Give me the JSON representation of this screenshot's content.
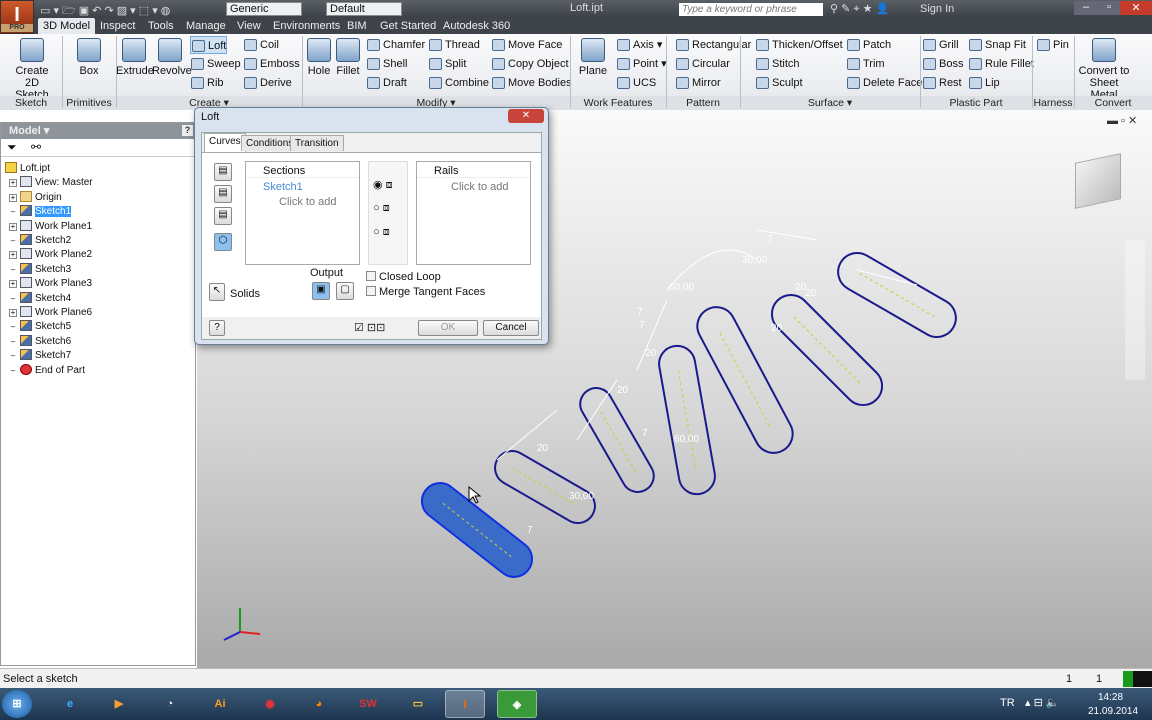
{
  "app": {
    "title": "Loft.ipt",
    "logo": "I",
    "edition": "PRO"
  },
  "quick_access": {
    "material": "Generic",
    "appearance": "Default"
  },
  "help": {
    "search_placeholder": "Type a keyword or phrase",
    "sign_in": "Sign In"
  },
  "tabs": [
    "3D Model",
    "Inspect",
    "Tools",
    "Manage",
    "View",
    "Environments",
    "BIM",
    "Get Started",
    "Autodesk 360"
  ],
  "ribbon": {
    "large": [
      "Create\n2D Sketch",
      "Box",
      "Extrude",
      "Revolve",
      "Hole",
      "Fillet",
      "Plane",
      "Convert to\nSheet Metal"
    ],
    "columns": [
      [
        "Loft",
        "Sweep",
        "Rib"
      ],
      [
        "Coil",
        "Emboss",
        "Derive"
      ],
      [
        "Chamfer",
        "Shell",
        "Draft"
      ],
      [
        "Thread",
        "Split",
        "Combine"
      ],
      [
        "Move Face",
        "Copy Object",
        "Move Bodies"
      ],
      [
        "Axis ▾",
        "Point ▾",
        "UCS"
      ],
      [
        "Rectangular",
        "Circular",
        "Mirror"
      ],
      [
        "Thicken/Offset",
        "Stitch",
        "Sculpt"
      ],
      [
        "Patch",
        "Trim",
        "Delete Face"
      ],
      [
        "Grill",
        "Boss",
        "Rest"
      ],
      [
        "Snap Fit",
        "Rule Fillet",
        "Lip"
      ],
      [
        "Pin",
        "",
        ""
      ]
    ],
    "selected": "Loft",
    "panels": [
      "Sketch",
      "Primitives",
      "Create ▾",
      "Modify ▾",
      "Work Features",
      "Pattern",
      "Surface ▾",
      "Plastic Part",
      "Harness",
      "Convert"
    ]
  },
  "browser": {
    "title": "Model ▾",
    "tree": [
      {
        "label": "Loft.ipt",
        "icon": "part",
        "level": 0
      },
      {
        "label": "View: Master",
        "icon": "view",
        "level": 1,
        "expand": true
      },
      {
        "label": "Origin",
        "icon": "folder",
        "level": 1,
        "expand": true
      },
      {
        "label": "Sketch1",
        "icon": "sketch",
        "level": 1,
        "selected": true
      },
      {
        "label": "Work Plane1",
        "icon": "plane",
        "level": 1,
        "expand": true
      },
      {
        "label": "Sketch2",
        "icon": "sketch",
        "level": 1
      },
      {
        "label": "Work Plane2",
        "icon": "plane",
        "level": 1,
        "expand": true
      },
      {
        "label": "Sketch3",
        "icon": "sketch",
        "level": 1
      },
      {
        "label": "Work Plane3",
        "icon": "plane",
        "level": 1,
        "expand": true
      },
      {
        "label": "Sketch4",
        "icon": "sketch",
        "level": 1
      },
      {
        "label": "Work Plane6",
        "icon": "plane",
        "level": 1,
        "expand": true
      },
      {
        "label": "Sketch5",
        "icon": "sketch",
        "level": 1
      },
      {
        "label": "Sketch6",
        "icon": "sketch",
        "level": 1
      },
      {
        "label": "Sketch7",
        "icon": "sketch",
        "level": 1
      },
      {
        "label": "End of Part",
        "icon": "end",
        "level": 1
      }
    ]
  },
  "dialog": {
    "title": "Loft",
    "tabs": [
      "Curves",
      "Conditions",
      "Transition"
    ],
    "sections_header": "Sections",
    "sections": [
      "Sketch1"
    ],
    "click_to_add": "Click to add",
    "rails_header": "Rails",
    "solids_label": "Solids",
    "output_label": "Output",
    "closed_loop": "Closed Loop",
    "merge_tangent": "Merge Tangent Faces",
    "ok": "OK",
    "cancel": "Cancel",
    "closed_loop_checked": false,
    "merge_tangent_checked": false,
    "preview_checked": true
  },
  "viewport": {
    "dimensions": [
      "7",
      "30,00",
      "20",
      "60,00",
      "7",
      "20",
      "7",
      "20",
      "20",
      "20",
      "60,00",
      "7",
      "20",
      "30,00",
      "7"
    ],
    "sketch_color": "#1a1a8c",
    "selected_fill": "#3b6bc9"
  },
  "status": {
    "message": "Select a sketch",
    "count1": "1",
    "count2": "1"
  },
  "taskbar": {
    "lang": "TR",
    "time": "14:28",
    "date": "21.09.2014"
  }
}
